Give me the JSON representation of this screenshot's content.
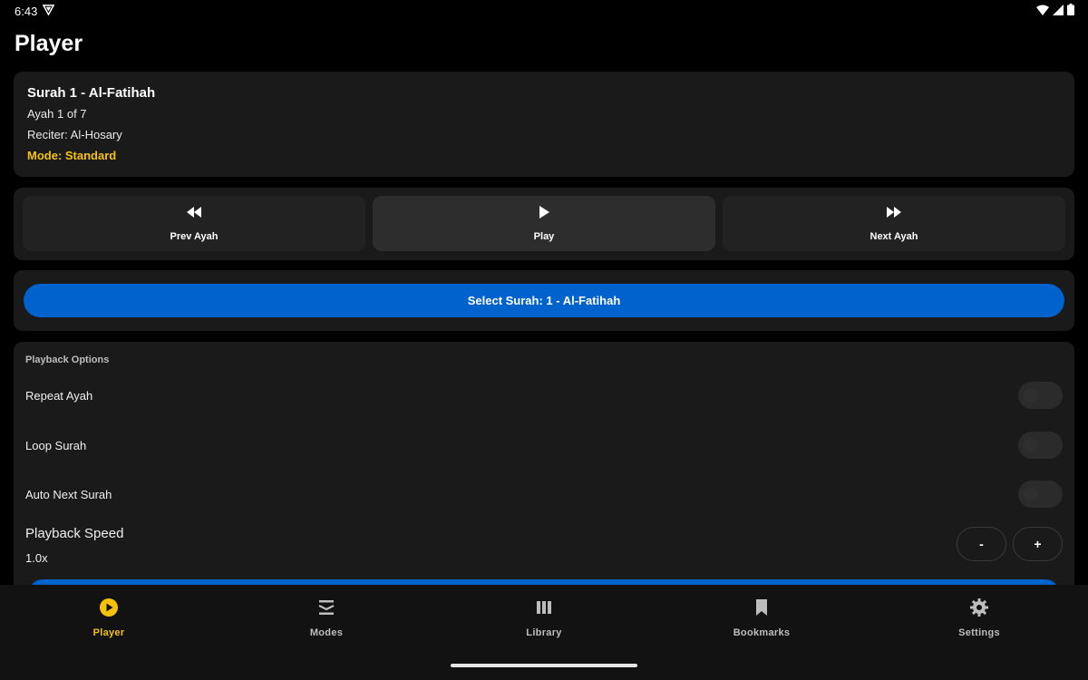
{
  "status_bar": {
    "time": "6:43"
  },
  "page": {
    "title": "Player"
  },
  "now_playing": {
    "surah_title": "Surah 1 - Al-Fatihah",
    "ayah": "Ayah 1 of 7",
    "reciter": "Reciter: Al-Hosary",
    "mode": "Mode: Standard"
  },
  "controls": {
    "prev_label": "Prev Ayah",
    "play_label": "Play",
    "next_label": "Next Ayah"
  },
  "select_surah": {
    "label": "Select Surah: 1 - Al-Fatihah"
  },
  "playback_options": {
    "header": "Playback Options",
    "repeat_ayah": {
      "label": "Repeat Ayah",
      "enabled": false
    },
    "loop_surah": {
      "label": "Loop Surah",
      "enabled": false
    },
    "auto_next_surah": {
      "label": "Auto Next Surah",
      "enabled": false
    },
    "speed_label": "Playback Speed",
    "speed_value": "1.0x",
    "decrease_label": "-",
    "increase_label": "+"
  },
  "bottom_nav": {
    "items": [
      {
        "label": "Player",
        "icon": "play-circle-icon",
        "active": true
      },
      {
        "label": "Modes",
        "icon": "modes-icon",
        "active": false
      },
      {
        "label": "Library",
        "icon": "library-icon",
        "active": false
      },
      {
        "label": "Bookmarks",
        "icon": "bookmark-icon",
        "active": false
      },
      {
        "label": "Settings",
        "icon": "gear-icon",
        "active": false
      }
    ]
  },
  "colors": {
    "accent": "#f4c20d",
    "primary_button": "#0062cc",
    "card_background": "#1a1a1a",
    "background": "#000000"
  }
}
